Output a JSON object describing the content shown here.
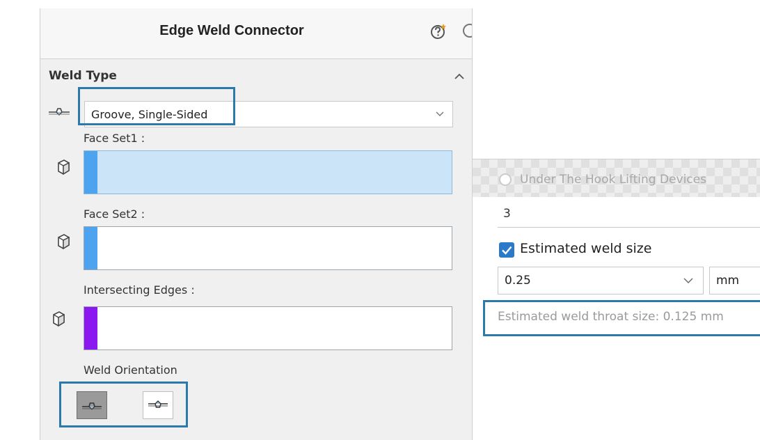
{
  "panel": {
    "title": "Edge Weld Connector",
    "section_title": "Weld Type",
    "weld_type": {
      "value": "Groove, Single-Sided"
    },
    "face_set1": {
      "label": "Face Set1 :"
    },
    "face_set2": {
      "label": "Face Set2 :"
    },
    "intersecting_edges": {
      "label": "Intersecting Edges :"
    },
    "weld_orientation": {
      "label": "Weld Orientation"
    }
  },
  "weld_options": {
    "standard_label": "Under The Hook Lifting Devices",
    "count_value": "3",
    "estimated_weld_size_label": "Estimated weld size",
    "estimated_weld_size_checked": true,
    "weld_size_value": "0.25",
    "unit": "mm",
    "throat_size_text": "Estimated weld throat size: 0.125 mm"
  },
  "colors": {
    "highlight": "#2b7aab",
    "face_set1_bar": "#4da3ef",
    "face_set1_fill": "#cce4f7",
    "face_set2_bar": "#4da3ef",
    "edges_bar": "#8b18f0",
    "checkbox": "#2b79c9"
  },
  "icons": {
    "help": "help-icon",
    "collapse": "chevron-up-icon",
    "weld_type": "groove-weld-icon",
    "face_select": "face-select-icon",
    "dropdown": "chevron-down-icon"
  }
}
